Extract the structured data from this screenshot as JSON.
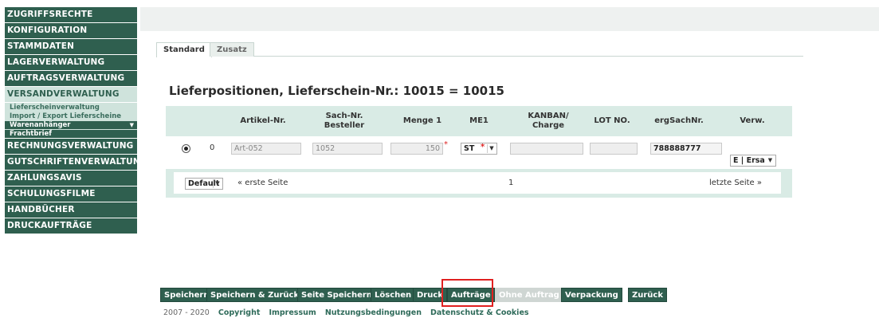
{
  "sidebar": {
    "items": [
      {
        "label": "ZUGRIFFSRECHTE"
      },
      {
        "label": "KONFIGURATION"
      },
      {
        "label": "STAMMDATEN"
      },
      {
        "label": "LAGERVERWALTUNG"
      },
      {
        "label": "AUFTRAGSVERWALTUNG"
      },
      {
        "label": "VERSANDVERWALTUNG"
      },
      {
        "label": "RECHNUNGSVERWALTUNG"
      },
      {
        "label": "GUTSCHRIFTENVERWALTUNG"
      },
      {
        "label": "ZAHLUNGSAVIS"
      },
      {
        "label": "SCHULUNGSFILME"
      },
      {
        "label": "HANDBÜCHER"
      },
      {
        "label": "DRUCKAUFTRÄGE"
      }
    ],
    "subitems": [
      {
        "label": "Lieferscheinverwaltung"
      },
      {
        "label": "Import / Export Lieferscheine"
      },
      {
        "label": "Warenanhänger"
      },
      {
        "label": "Frachtbrief"
      }
    ]
  },
  "tabs": [
    {
      "label": "Standard"
    },
    {
      "label": "Zusatz"
    }
  ],
  "heading": "Lieferpositionen, Lieferschein-Nr.: 10015 = 10015",
  "table": {
    "headers": [
      "Artikel-Nr.",
      "Sach-Nr. Besteller",
      "Menge 1",
      "ME1",
      "KANBAN/ Charge",
      "LOT NO.",
      "ergSachNr.",
      "Verw."
    ],
    "row": {
      "index": "0",
      "artikel": "Art-052",
      "sachnr": "1052",
      "menge": "150",
      "me1": "ST",
      "kanban": "",
      "lot": "",
      "ergsachnr": "788888777",
      "verw": "E | Ersa"
    }
  },
  "pager": {
    "select_value": "Default",
    "first": "« erste Seite",
    "page": "1",
    "last": "letzte Seite »"
  },
  "buttons": [
    {
      "label": "Speichern"
    },
    {
      "label": "Speichern & Zurück"
    },
    {
      "label": "Seite Speichern"
    },
    {
      "label": "Löschen"
    },
    {
      "label": "Druck"
    },
    {
      "label": "Aufträge"
    },
    {
      "label": "Ohne Auftrag"
    },
    {
      "label": "Verpackung"
    },
    {
      "label": "Zurück"
    }
  ],
  "footer": {
    "years": "2007 - 2020",
    "links": [
      "Copyright",
      "Impressum",
      "Nutzungsbedingungen",
      "Datenschutz & Cookies"
    ]
  },
  "colors": {
    "nav_bg": "#2f5f4f",
    "nav_active_bg": "#cfe3dc",
    "table_header_bg": "#d9ebe5",
    "highlight": "#e02020"
  }
}
